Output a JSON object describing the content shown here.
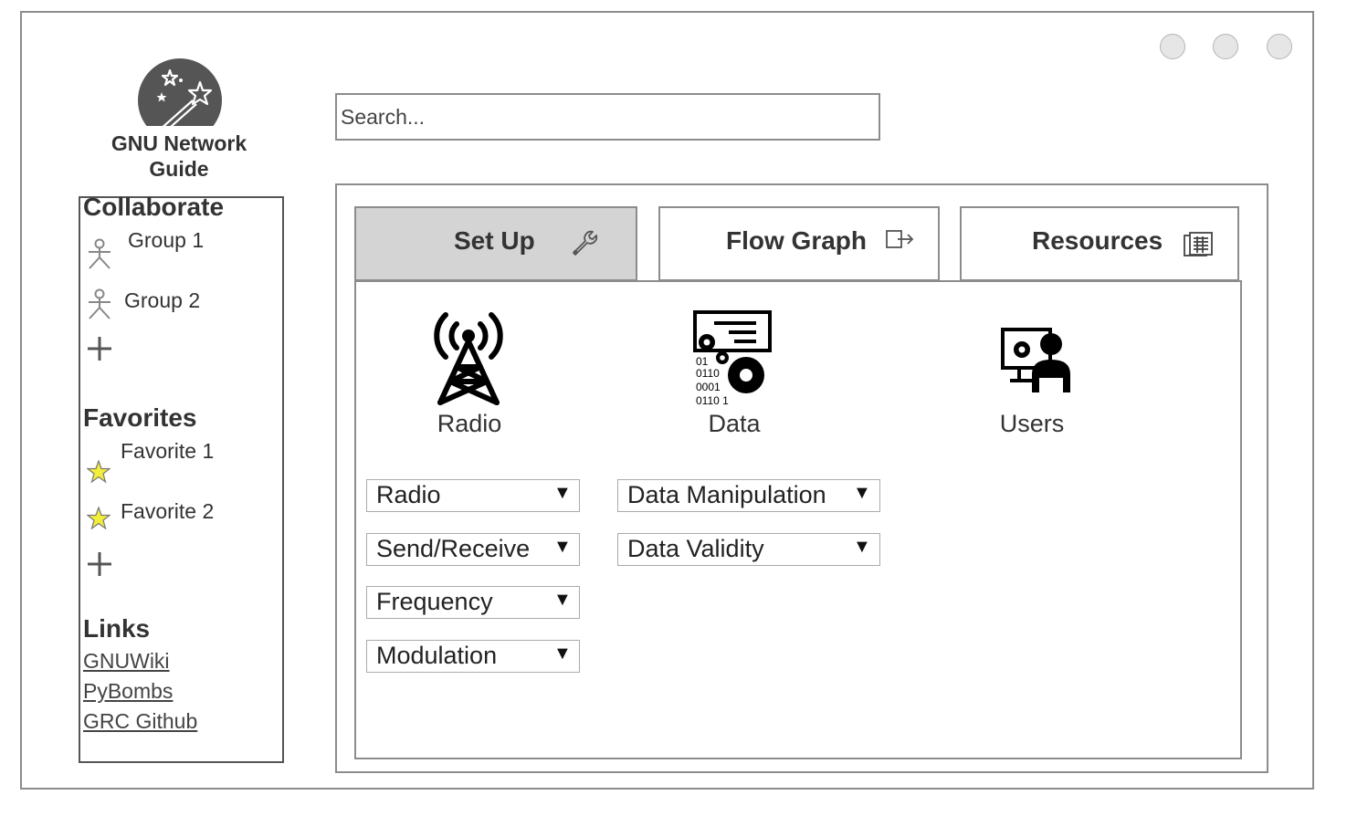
{
  "window": {
    "controls": [
      "window-control",
      "window-control",
      "window-control"
    ]
  },
  "app": {
    "title": "GNU Network\nGuide",
    "logo_icon": "magic-wand-icon"
  },
  "search": {
    "placeholder": "Search..."
  },
  "sidebar": {
    "collaborate": {
      "title": "Collaborate",
      "items": [
        {
          "label": "Group 1",
          "icon": "person-icon"
        },
        {
          "label": "Group 2",
          "icon": "person-icon"
        }
      ],
      "add_icon": "plus-icon"
    },
    "favorites": {
      "title": "Favorites",
      "items": [
        {
          "label": "Favorite 1",
          "icon": "star-icon"
        },
        {
          "label": "Favorite 2",
          "icon": "star-icon"
        }
      ],
      "add_icon": "plus-icon",
      "star_color": "#f2ee3a"
    },
    "links": {
      "title": "Links",
      "items": [
        "GNUWiki",
        "PyBombs",
        "GRC Github"
      ]
    }
  },
  "tabs": [
    {
      "label": "Set Up",
      "icon": "wrench-icon",
      "active": true
    },
    {
      "label": "Flow Graph",
      "icon": "export-icon",
      "active": false
    },
    {
      "label": "Resources",
      "icon": "document-icon",
      "active": false
    }
  ],
  "categories": [
    {
      "label": "Radio",
      "icon": "radio-tower-icon"
    },
    {
      "label": "Data",
      "icon": "data-gears-icon"
    },
    {
      "label": "Users",
      "icon": "user-computer-icon"
    }
  ],
  "dropdowns": {
    "left": [
      {
        "label": "Radio"
      },
      {
        "label": "Send/Receive"
      },
      {
        "label": "Frequency"
      },
      {
        "label": "Modulation"
      }
    ],
    "right": [
      {
        "label": "Data Manipulation"
      },
      {
        "label": "Data Validity"
      }
    ],
    "arrow": "▼"
  },
  "data_icon_text": [
    "01",
    "0110",
    "0001",
    "0110 1"
  ],
  "colors": {
    "active_tab": "#d4d4d4",
    "border": "#8c8c8c"
  }
}
